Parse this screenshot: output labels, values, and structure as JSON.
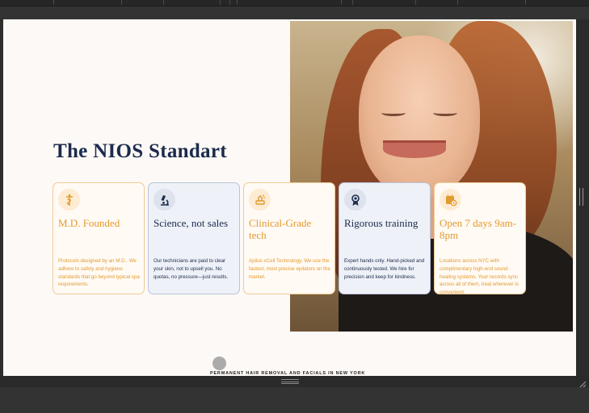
{
  "page": {
    "headline": "The NIOS Standart",
    "tagline": "PERMANENT HAIR REMOVAL AND FACIALS IN NEW YORK"
  },
  "colors": {
    "accent_orange": "#e39a2e",
    "navy": "#1c2b4d",
    "background": "#fdf9f6"
  },
  "cards": [
    {
      "icon": "caduceus-icon",
      "style": "orange",
      "title": "M.D. Founded",
      "desc": "Protocols designed by an M.D.. We adhere to safety and hygiene standards that go beyond typical spa requirements."
    },
    {
      "icon": "microscope-icon",
      "style": "navy",
      "title": "Science, not sales",
      "desc": "Our technicians are paid to clear your skin, not to upsell you. No quotas, no pressure—just results."
    },
    {
      "icon": "laser-device-icon",
      "style": "orange",
      "title": "Clinical-Grade tech",
      "desc": "Apilus xCell Technology. We use the fastest, most precise epilators on the market."
    },
    {
      "icon": "award-ribbon-icon",
      "style": "navy",
      "title": "Rigorous training",
      "desc": "Expert hands only. Hand-picked and continuously tested. We hire for precision and keep for kindness."
    },
    {
      "icon": "calendar-clock-icon",
      "style": "orange",
      "title": "Open 7 days 9am-8pm",
      "desc": "Locations across NYC with complimentary high-end sound healing systems. Your records sync across all of them, treat wherever is convenient."
    }
  ]
}
